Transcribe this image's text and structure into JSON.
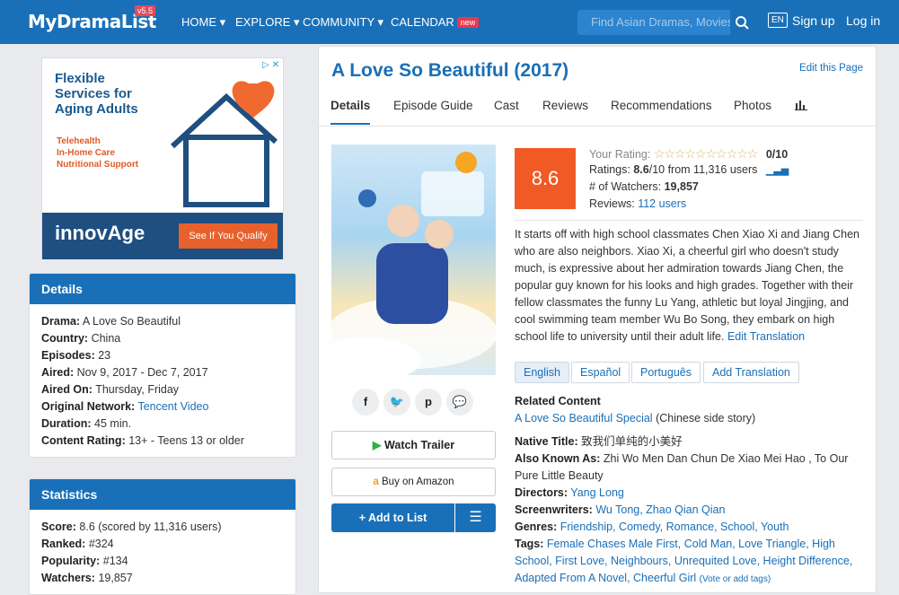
{
  "header": {
    "logo": "MyDramaList",
    "version": "v5.5",
    "nav": [
      "HOME",
      "EXPLORE",
      "COMMUNITY",
      "CALENDAR"
    ],
    "calendar_badge": "new",
    "search_placeholder": "Find Asian Dramas, Movies, A",
    "lang": "EN",
    "signup": "Sign up",
    "login": "Log in"
  },
  "ad": {
    "title": "Flexible Services for Aging Adults",
    "lines": [
      "Telehealth",
      "In-Home Care",
      "Nutritional Support"
    ],
    "brand": "innovAge",
    "cta": "See If You Qualify"
  },
  "details_box": {
    "heading": "Details",
    "rows": [
      {
        "label": "Drama:",
        "value": "A Love So Beautiful"
      },
      {
        "label": "Country:",
        "value": "China"
      },
      {
        "label": "Episodes:",
        "value": "23"
      },
      {
        "label": "Aired:",
        "value": "Nov 9, 2017 - Dec 7, 2017"
      },
      {
        "label": "Aired On:",
        "value": "Thursday, Friday"
      },
      {
        "label": "Original Network:",
        "value": "Tencent Video"
      },
      {
        "label": "Duration:",
        "value": "45 min."
      },
      {
        "label": "Content Rating:",
        "value": "13+ - Teens 13 or older"
      }
    ]
  },
  "stats_box": {
    "heading": "Statistics",
    "rows": [
      {
        "label": "Score:",
        "value": "8.6 (scored by 11,316 users)"
      },
      {
        "label": "Ranked:",
        "value": "#324"
      },
      {
        "label": "Popularity:",
        "value": "#134"
      },
      {
        "label": "Watchers:",
        "value": "19,857"
      }
    ]
  },
  "main": {
    "title": "A Love So Beautiful (2017)",
    "edit": "Edit this Page",
    "tabs": [
      "Details",
      "Episode Guide",
      "Cast",
      "Reviews",
      "Recommendations",
      "Photos"
    ],
    "watch_trailer": "Watch Trailer",
    "buy_amazon": "Buy on Amazon",
    "add_to_list": "Add to List",
    "score": "8.6",
    "your_rating_label": "Your Rating:",
    "your_rating_value": "0/10",
    "ratings_label": "Ratings:",
    "ratings_score": "8.6",
    "ratings_rest": "/10 from 11,316 users",
    "watchers_label": "# of Watchers:",
    "watchers_value": "19,857",
    "reviews_label": "Reviews:",
    "reviews_value": "112 users",
    "synopsis": "It starts off with high school classmates Chen Xiao Xi and Jiang Chen who are also neighbors. Xiao Xi, a cheerful girl who doesn't study much, is expressive about her admiration towards Jiang Chen, the popular guy known for his looks and high grades. Together with their fellow classmates the funny Lu Yang, athletic but loyal Jingjing, and cool swimming team member Wu Bo Song, they embark on high school life to university until their adult life.",
    "edit_translation": "Edit Translation",
    "languages": [
      "English",
      "Español",
      "Português",
      "Add Translation"
    ],
    "related_heading": "Related Content",
    "related_link": "A Love So Beautiful Special",
    "related_note": "(Chinese side story)",
    "native_title_label": "Native Title:",
    "native_title": "致我们单纯的小美好",
    "aka_label": "Also Known As:",
    "aka": "Zhi Wo Men Dan Chun De Xiao Mei Hao , To Our Pure Little Beauty",
    "directors_label": "Directors:",
    "directors": "Yang Long",
    "screenwriters_label": "Screenwriters:",
    "screenwriters": "Wu Tong, Zhao Qian Qian",
    "genres_label": "Genres:",
    "genres": "Friendship, Comedy, Romance, School, Youth",
    "tags_label": "Tags:",
    "tags": "Female Chases Male First, Cold Man, Love Triangle, High School, First Love, Neighbours, Unrequited Love, Height Difference, Adapted From A Novel, Cheerful Girl",
    "tags_vote": "(Vote or add tags)"
  }
}
